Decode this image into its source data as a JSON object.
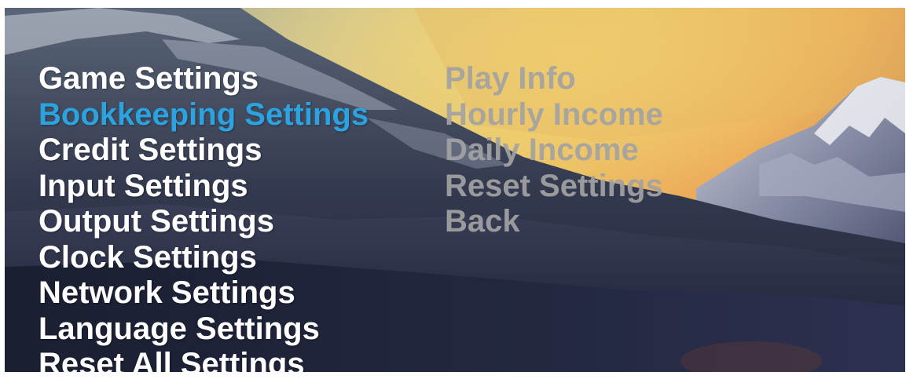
{
  "menu": {
    "selected_index": 1,
    "items": [
      {
        "label": "Game Settings"
      },
      {
        "label": "Bookkeeping Settings"
      },
      {
        "label": "Credit Settings"
      },
      {
        "label": "Input Settings"
      },
      {
        "label": "Output Settings"
      },
      {
        "label": "Clock Settings"
      },
      {
        "label": "Network Settings"
      },
      {
        "label": "Language Settings"
      },
      {
        "label": "Reset All Settings"
      }
    ]
  },
  "submenu": {
    "items": [
      {
        "label": "Play Info"
      },
      {
        "label": "Hourly Income"
      },
      {
        "label": "Daily Income"
      },
      {
        "label": "Reset Settings"
      },
      {
        "label": "Back"
      }
    ]
  },
  "colors": {
    "selected": "#2ca2e0",
    "normal": "#ffffff",
    "submenu_inactive": "#a3a3a3"
  }
}
